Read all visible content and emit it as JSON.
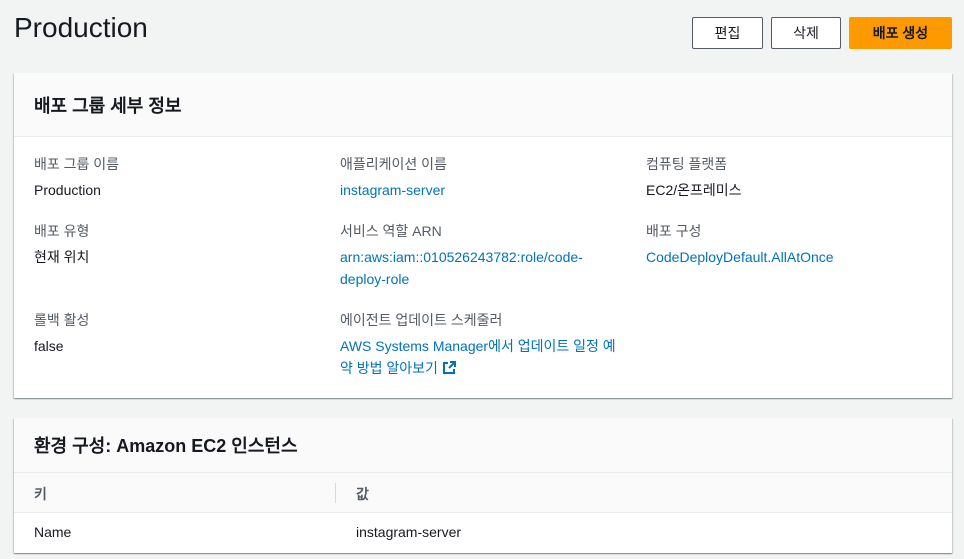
{
  "header": {
    "title": "Production",
    "edit_label": "편집",
    "delete_label": "삭제",
    "create_label": "배포 생성"
  },
  "details_panel": {
    "title": "배포 그룹 세부 정보",
    "fields": {
      "group_name": {
        "label": "배포 그룹 이름",
        "value": "Production"
      },
      "app_name": {
        "label": "애플리케이션 이름",
        "value": "instagram-server"
      },
      "platform": {
        "label": "컴퓨팅 플랫폼",
        "value": "EC2/온프레미스"
      },
      "deploy_type": {
        "label": "배포 유형",
        "value": "현재 위치"
      },
      "service_role": {
        "label": "서비스 역할 ARN",
        "value_line1": "arn:aws:iam::010526243782:role/code-",
        "value_line2": "deploy-role"
      },
      "deploy_config": {
        "label": "배포 구성",
        "value": "CodeDeployDefault.AllAtOnce"
      },
      "rollback": {
        "label": "롤백 활성",
        "value": "false"
      },
      "agent_scheduler": {
        "label": "에이전트 업데이트 스케줄러",
        "value_line1": "AWS Systems Manager에서 업데이트 일정 예",
        "value_line2": "약 방법 알아보기"
      }
    }
  },
  "env_panel": {
    "title": "환경 구성: Amazon EC2 인스턴스",
    "columns": {
      "key": "키",
      "value": "값"
    },
    "rows": [
      {
        "key": "Name",
        "value": "instagram-server"
      }
    ]
  },
  "colors": {
    "primary_button": "#ff9900",
    "link": "#0073bb",
    "background": "#f2f3f3"
  }
}
